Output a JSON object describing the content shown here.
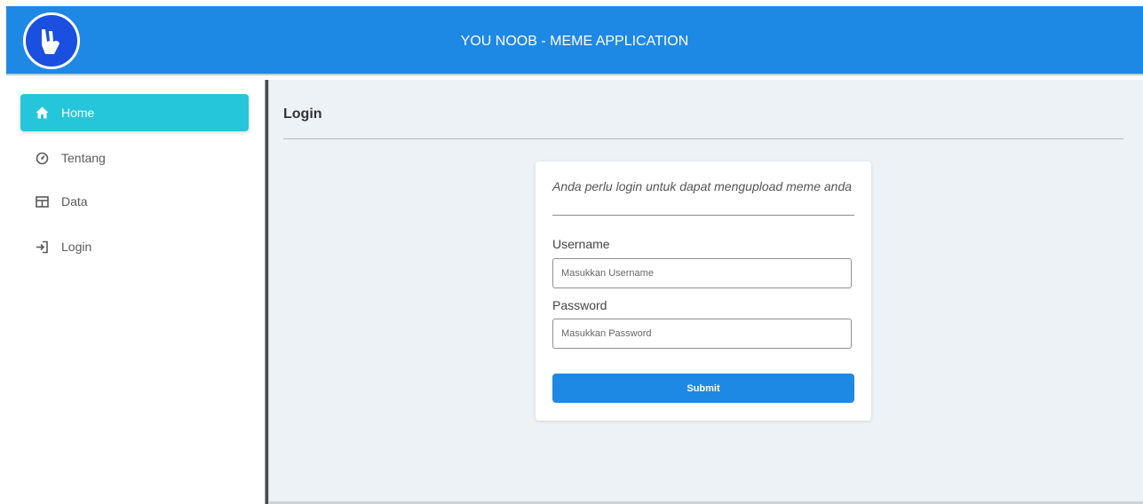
{
  "header": {
    "title": "YOU NOOB - MEME APPLICATION",
    "logo_icon": "rock-hand-icon",
    "brand_color": "#1e88e5"
  },
  "sidebar": {
    "items": [
      {
        "label": "Home",
        "icon": "home-icon",
        "active": true
      },
      {
        "label": "Tentang",
        "icon": "dashboard-icon",
        "active": false
      },
      {
        "label": "Data",
        "icon": "table-icon",
        "active": false
      },
      {
        "label": "Login",
        "icon": "login-icon",
        "active": false
      }
    ],
    "active_color": "#26c6da"
  },
  "main": {
    "title": "Login",
    "card": {
      "note": "Anda perlu login untuk dapat mengupload meme anda",
      "username_label": "Username",
      "username_placeholder": "Masukkan Username",
      "username_value": "",
      "password_label": "Password",
      "password_placeholder": "Masukkan Password",
      "password_value": "",
      "submit_label": "Submit"
    }
  }
}
